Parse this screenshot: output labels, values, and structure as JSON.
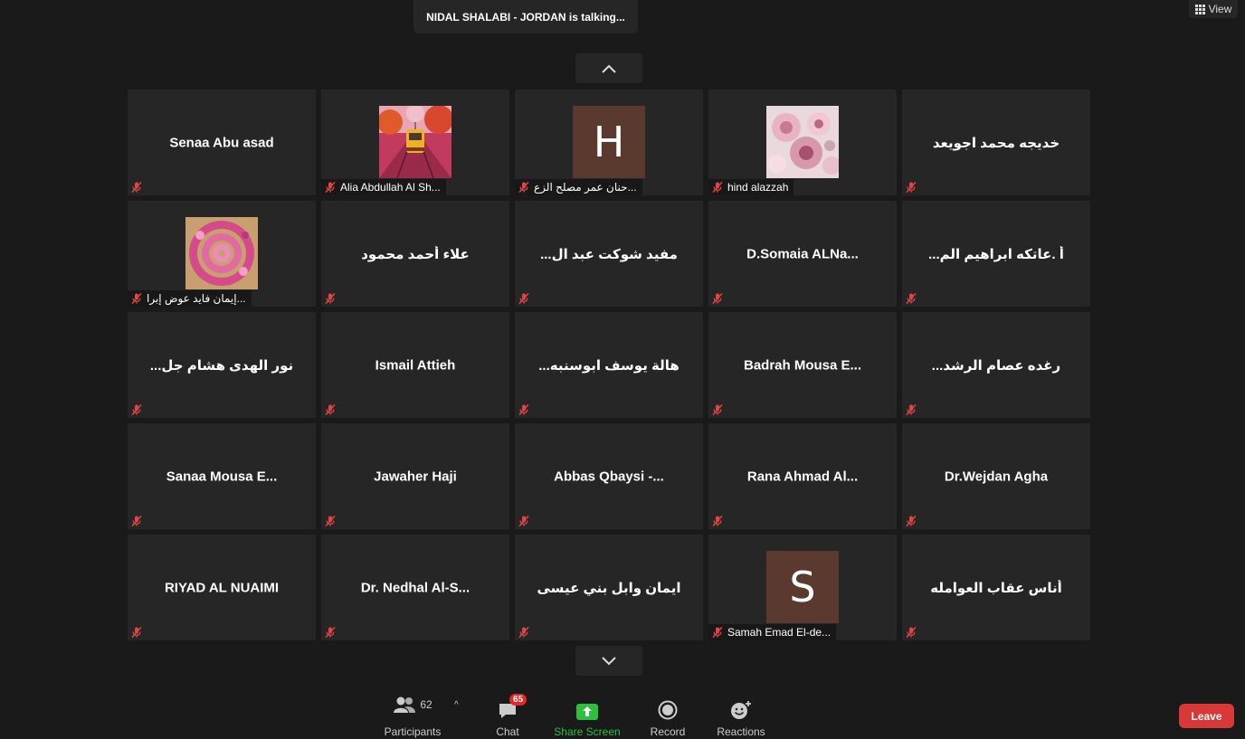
{
  "talking_indicator": "NIDAL SHALABI - JORDAN is talking...",
  "view_button": "View",
  "colors": {
    "background": "#1a1a1a",
    "tile": "#262626",
    "mic_muted": "#e04444",
    "share_green": "#2fbf3f",
    "leave": "#d93838",
    "badge": "#e02828"
  },
  "tiles": [
    {
      "name": "Senaa Abu asad"
    },
    {
      "label": "Alia Abdullah Al Sh...",
      "avatar": "tram-photo"
    },
    {
      "label": "حنان عمر مصلح الزع...",
      "avatar": "letter",
      "letter": "H"
    },
    {
      "label": "hind alazzah",
      "avatar": "flowers-photo"
    },
    {
      "name": "خديجه محمد اجويعد"
    },
    {
      "label": "إيمان فايد عوض إبرا...",
      "avatar": "spiral-photo"
    },
    {
      "name": "علاء أحمد محمود"
    },
    {
      "name": "مفيد شوكت عبد ال..."
    },
    {
      "name": "D.Somaia  ALNa..."
    },
    {
      "name": "أ .عاتكه ابراهيم الم..."
    },
    {
      "name": "نور الهدى هشام جل..."
    },
    {
      "name": "Ismail Attieh"
    },
    {
      "name": "هالة يوسف ابوسنبه..."
    },
    {
      "name": "Badrah  Mousa  E..."
    },
    {
      "name": "رغده عصام   الرشد..."
    },
    {
      "name": "Sanaa  Mousa   E..."
    },
    {
      "name": "Jawaher Haji"
    },
    {
      "name": "Abbas  Qbaysi  -..."
    },
    {
      "name": "Rana  Ahmad  Al..."
    },
    {
      "name": "Dr.Wejdan Agha"
    },
    {
      "name": "RIYAD AL NUAIMI"
    },
    {
      "name": "Dr.  Nedhal Al-S..."
    },
    {
      "name": "ايمان وابل بني عيسى"
    },
    {
      "label": "Samah Emad El-de...",
      "avatar": "letter",
      "letter": "S"
    },
    {
      "name": "أناس عقاب العوامله"
    }
  ],
  "toolbar": {
    "participants": {
      "label": "Participants",
      "count": "62"
    },
    "chat": {
      "label": "Chat",
      "badge": "65"
    },
    "share": {
      "label": "Share Screen"
    },
    "record": {
      "label": "Record"
    },
    "reactions": {
      "label": "Reactions"
    }
  },
  "leave_button": "Leave"
}
